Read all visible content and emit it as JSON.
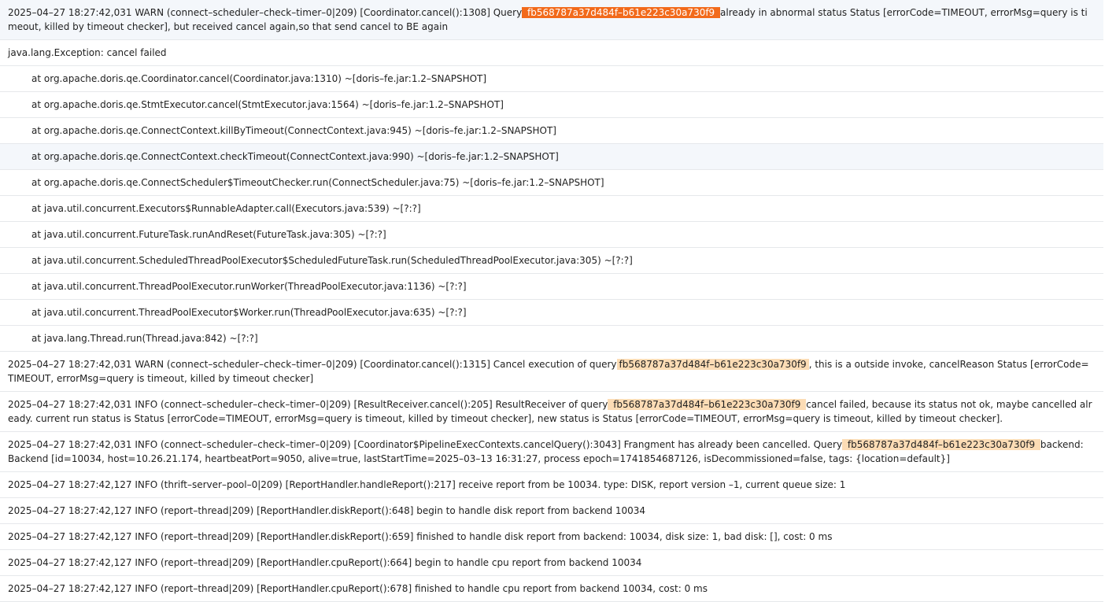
{
  "accent": {
    "match": "#fcdcb5",
    "current_match": "#f26a1b",
    "row_hover": "#f4f7fb"
  },
  "lines": [
    {
      "kind": "log",
      "active": true,
      "segments": [
        {
          "t": "2025–04–27 18:27:42,031 WARN (connect–scheduler–check–timer–0|209) [Coordinator.cancel():1308] Query"
        },
        {
          "t": " fb568787a37d484f–b61e223c30a730f9 ",
          "hl": "current"
        },
        {
          "t": "already in abnormal status Status [errorCode=TIMEOUT, errorMsg=query is timeout, killed by timeout checker], but received cancel again,so that send cancel to BE again"
        }
      ]
    },
    {
      "kind": "log",
      "segments": [
        {
          "t": "java.lang.Exception: cancel failed"
        }
      ]
    },
    {
      "kind": "stack",
      "segments": [
        {
          "t": "at org.apache.doris.qe.Coordinator.cancel(Coordinator.java:1310) ~[doris–fe.jar:1.2–SNAPSHOT]"
        }
      ]
    },
    {
      "kind": "stack",
      "segments": [
        {
          "t": "at org.apache.doris.qe.StmtExecutor.cancel(StmtExecutor.java:1564) ~[doris–fe.jar:1.2–SNAPSHOT]"
        }
      ]
    },
    {
      "kind": "stack",
      "segments": [
        {
          "t": "at org.apache.doris.qe.ConnectContext.killByTimeout(ConnectContext.java:945) ~[doris–fe.jar:1.2–SNAPSHOT]"
        }
      ]
    },
    {
      "kind": "stack",
      "active": true,
      "segments": [
        {
          "t": "at org.apache.doris.qe.ConnectContext.checkTimeout(ConnectContext.java:990) ~[doris–fe.jar:1.2–SNAPSHOT]"
        }
      ]
    },
    {
      "kind": "stack",
      "segments": [
        {
          "t": "at org.apache.doris.qe.ConnectScheduler$TimeoutChecker.run(ConnectScheduler.java:75) ~[doris–fe.jar:1.2–SNAPSHOT]"
        }
      ]
    },
    {
      "kind": "stack",
      "segments": [
        {
          "t": "at java.util.concurrent.Executors$RunnableAdapter.call(Executors.java:539) ~[?:?]"
        }
      ]
    },
    {
      "kind": "stack",
      "segments": [
        {
          "t": "at java.util.concurrent.FutureTask.runAndReset(FutureTask.java:305) ~[?:?]"
        }
      ]
    },
    {
      "kind": "stack",
      "segments": [
        {
          "t": "at java.util.concurrent.ScheduledThreadPoolExecutor$ScheduledFutureTask.run(ScheduledThreadPoolExecutor.java:305) ~[?:?]"
        }
      ]
    },
    {
      "kind": "stack",
      "segments": [
        {
          "t": "at java.util.concurrent.ThreadPoolExecutor.runWorker(ThreadPoolExecutor.java:1136) ~[?:?]"
        }
      ]
    },
    {
      "kind": "stack",
      "segments": [
        {
          "t": "at java.util.concurrent.ThreadPoolExecutor$Worker.run(ThreadPoolExecutor.java:635) ~[?:?]"
        }
      ]
    },
    {
      "kind": "stack",
      "segments": [
        {
          "t": "at java.lang.Thread.run(Thread.java:842) ~[?:?]"
        }
      ]
    },
    {
      "kind": "log",
      "segments": [
        {
          "t": "2025–04–27 18:27:42,031 WARN (connect–scheduler–check–timer–0|209) [Coordinator.cancel():1315] Cancel execution of query"
        },
        {
          "t": "fb568787a37d484f–b61e223c30a730f9",
          "hl": "match"
        },
        {
          "t": ", this is a outside invoke, cancelReason Status [errorCode=TIMEOUT, errorMsg=query is timeout, killed by timeout checker]"
        }
      ]
    },
    {
      "kind": "log",
      "segments": [
        {
          "t": "2025–04–27 18:27:42,031 INFO (connect–scheduler–check–timer–0|209) [ResultReceiver.cancel():205] ResultReceiver of query"
        },
        {
          "t": " fb568787a37d484f–b61e223c30a730f9 ",
          "hl": "match"
        },
        {
          "t": "cancel failed, because its status not ok, maybe cancelled already. current run status is Status [errorCode=TIMEOUT, errorMsg=query is timeout, killed by timeout checker], new status is Status [errorCode=TIMEOUT, errorMsg=query is timeout, killed by timeout checker]."
        }
      ]
    },
    {
      "kind": "log",
      "segments": [
        {
          "t": "2025–04–27 18:27:42,031 INFO (connect–scheduler–check–timer–0|209) [Coordinator$PipelineExecContexts.cancelQuery():3043] Frangment has already been cancelled. Query"
        },
        {
          "t": " fb568787a37d484f–b61e223c30a730f9 ",
          "hl": "match"
        },
        {
          "t": "backend: Backend [id=10034, host=10.26.21.174, heartbeatPort=9050, alive=true, lastStartTime=2025–03–13 16:31:27, process epoch=1741854687126, isDecommissioned=false, tags: {location=default}]"
        }
      ]
    },
    {
      "kind": "log",
      "segments": [
        {
          "t": "2025–04–27 18:27:42,127 INFO (thrift–server–pool–0|209) [ReportHandler.handleReport():217] receive report from be 10034. type: DISK, report version –1, current queue size: 1"
        }
      ]
    },
    {
      "kind": "log",
      "segments": [
        {
          "t": "2025–04–27 18:27:42,127 INFO (report–thread|209) [ReportHandler.diskReport():648] begin to handle disk report from backend 10034"
        }
      ]
    },
    {
      "kind": "log",
      "segments": [
        {
          "t": "2025–04–27 18:27:42,127 INFO (report–thread|209) [ReportHandler.diskReport():659] finished to handle disk report from backend: 10034, disk size: 1, bad disk: [], cost: 0 ms"
        }
      ]
    },
    {
      "kind": "log",
      "segments": [
        {
          "t": "2025–04–27 18:27:42,127 INFO (report–thread|209) [ReportHandler.cpuReport():664] begin to handle cpu report from backend 10034"
        }
      ]
    },
    {
      "kind": "log",
      "segments": [
        {
          "t": "2025–04–27 18:27:42,127 INFO (report–thread|209) [ReportHandler.cpuReport():678] finished to handle cpu report from backend 10034, cost: 0 ms"
        }
      ]
    }
  ]
}
